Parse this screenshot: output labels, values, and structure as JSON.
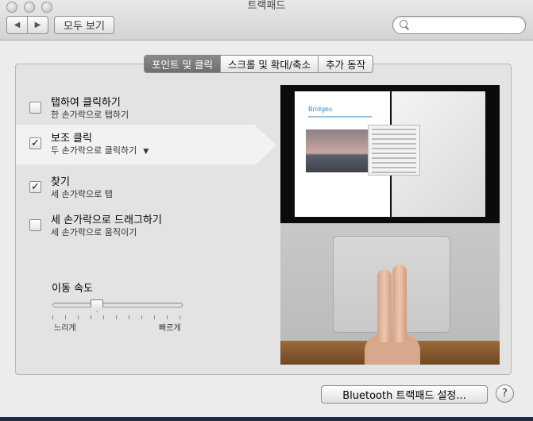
{
  "window": {
    "title": "트랙패드"
  },
  "toolbar": {
    "back_label": "◀",
    "forward_label": "▶",
    "show_all_label": "모두 보기",
    "search_placeholder": ""
  },
  "tabs": [
    {
      "label": "포인트 및 클릭",
      "active": true
    },
    {
      "label": "스크롤 및 확대/축소",
      "active": false
    },
    {
      "label": "추가 동작",
      "active": false
    }
  ],
  "options": [
    {
      "title": "탭하여 클릭하기",
      "subtitle": "한 손가락으로 탭하기",
      "checked": false
    },
    {
      "title": "보조 클릭",
      "subtitle": "두 손가락으로 클릭하기",
      "checked": true,
      "has_dropdown": true
    },
    {
      "title": "찾기",
      "subtitle": "세 손가락으로 탭",
      "checked": true
    },
    {
      "title": "세 손가락으로 드래그하기",
      "subtitle": "세 손가락으로 움직이기",
      "checked": false
    }
  ],
  "tracking_speed": {
    "label": "이동 속도",
    "slow_label": "느리게",
    "fast_label": "빠르게",
    "value": 0.35
  },
  "preview": {
    "doc_title": "Bridges"
  },
  "bottom": {
    "bluetooth_button": "Bluetooth 트랙패드 설정...",
    "help_label": "?"
  },
  "colors": {
    "accent": "#3b8ac6"
  }
}
